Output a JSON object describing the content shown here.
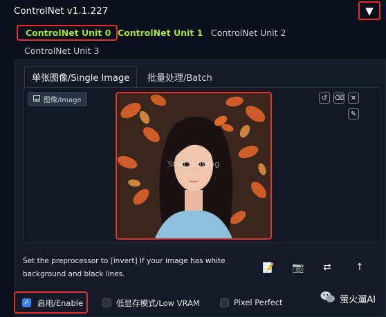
{
  "header": {
    "title": "ControlNet v1.1.227",
    "collapse_icon": "▼"
  },
  "unit_tabs": [
    {
      "label": "ControlNet Unit 0"
    },
    {
      "label": "ControlNet Unit 1"
    },
    {
      "label": "ControlNet Unit 2"
    },
    {
      "label": "ControlNet Unit 3"
    }
  ],
  "mode_tabs": [
    {
      "label": "单张图像/Single Image"
    },
    {
      "label": "批量处理/Batch"
    }
  ],
  "image_input": {
    "label": "图像/Image",
    "overlay": "Start drawing"
  },
  "hint": "Set the preprocessor to [invert] If your image has white background and black lines.",
  "checkboxes": [
    {
      "label": "启用/Enable",
      "checked": true
    },
    {
      "label": "低显存模式/Low VRAM",
      "checked": false
    },
    {
      "label": "Pixel Perfect",
      "checked": false
    }
  ],
  "watermark": {
    "text": "萤火遛AI"
  },
  "colors": {
    "accent_red": "#e0332b",
    "active_green": "#a6e22e",
    "checkbox_blue": "#3b82f6",
    "background": "#0b0f19"
  }
}
